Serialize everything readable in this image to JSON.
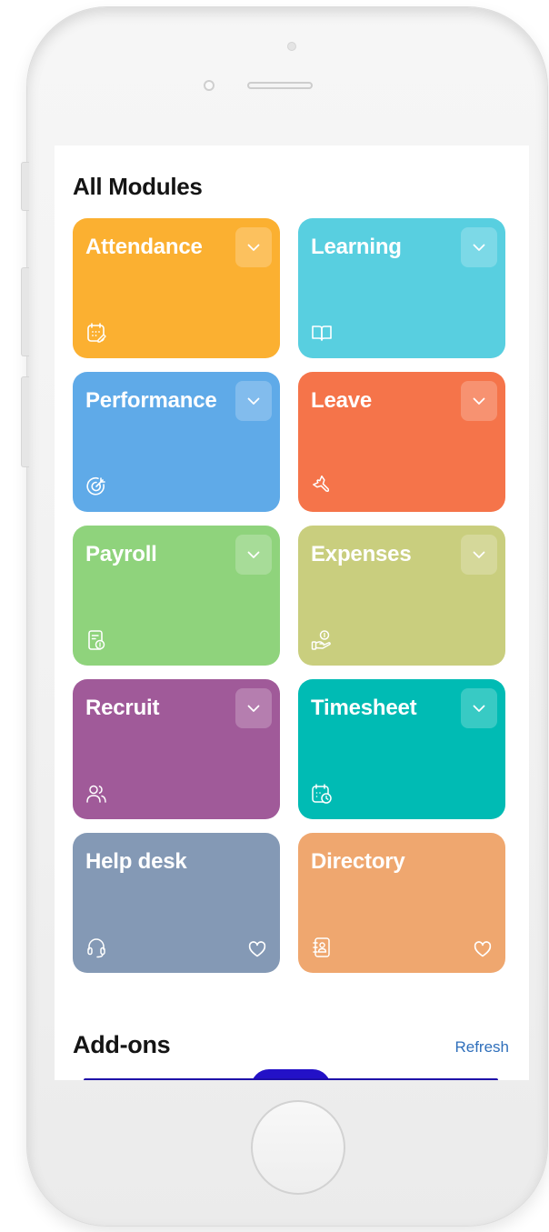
{
  "modules": {
    "title": "All Modules",
    "tiles": [
      {
        "label": "Attendance",
        "color": "#FBB031",
        "icon": "calendar-edit-icon",
        "has_chevron": true
      },
      {
        "label": "Learning",
        "color": "#58CFE0",
        "icon": "open-book-icon",
        "has_chevron": true
      },
      {
        "label": "Performance",
        "color": "#5FAAE8",
        "icon": "target-icon",
        "has_chevron": true
      },
      {
        "label": "Leave",
        "color": "#F5744A",
        "icon": "airplane-icon",
        "has_chevron": true
      },
      {
        "label": "Payroll",
        "color": "#8FD37C",
        "icon": "payslip-icon",
        "has_chevron": true
      },
      {
        "label": "Expenses",
        "color": "#C9CE7E",
        "icon": "hand-coin-icon",
        "has_chevron": true
      },
      {
        "label": "Recruit",
        "color": "#A05A99",
        "icon": "users-icon",
        "has_chevron": true
      },
      {
        "label": "Timesheet",
        "color": "#00BBB4",
        "icon": "calendar-clock-icon",
        "has_chevron": true
      },
      {
        "label": "Help desk",
        "color": "#8499B5",
        "icon": "headset-icon",
        "has_chevron": false,
        "favorite_icon": "heart-outline-icon"
      },
      {
        "label": "Directory",
        "color": "#EFA76F",
        "icon": "contact-book-icon",
        "has_chevron": false,
        "favorite_icon": "heart-outline-icon"
      }
    ]
  },
  "addons": {
    "title": "Add-ons",
    "refresh_label": "Refresh"
  }
}
